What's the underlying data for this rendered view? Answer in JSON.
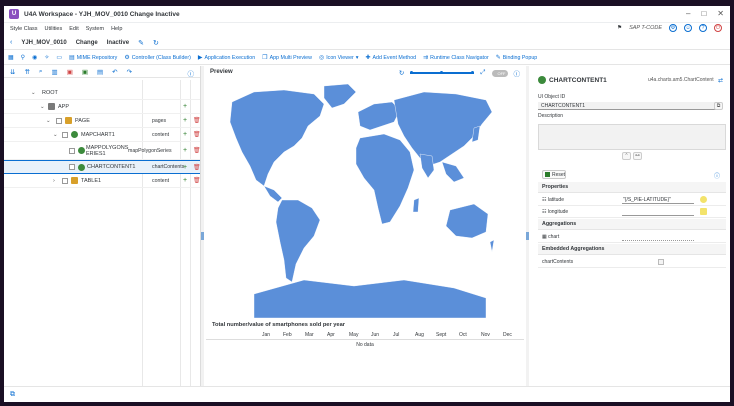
{
  "window": {
    "title": "U4A Workspace - YJH_MOV_0010 Change Inactive"
  },
  "menu": {
    "items": [
      "Style Class",
      "Utilities",
      "Edit",
      "System",
      "Help"
    ],
    "tcode_placeholder": "SAP T-CODE"
  },
  "object_bar": {
    "name": "YJH_MOV_0010",
    "mode": "Change",
    "status": "Inactive"
  },
  "toolbar": {
    "items": [
      "MIME Repository",
      "Controller (Class Builder)",
      "Application Execution",
      "App Multi Preview",
      "Icon Viewer",
      "Add Event Method",
      "Runtime Class Navigator",
      "Binding Popup"
    ]
  },
  "tree": {
    "rows": [
      {
        "label": "ROOT",
        "aggregation": "",
        "level": 0
      },
      {
        "label": "APP",
        "aggregation": "",
        "level": 1
      },
      {
        "label": "PAGE",
        "aggregation": "pages",
        "level": 2
      },
      {
        "label": "MAPCHART1",
        "aggregation": "content",
        "level": 3
      },
      {
        "label": "MAPPOLYGONSERIES1",
        "aggregation": "mapPolygonSeries",
        "level": 4
      },
      {
        "label": "CHARTCONTENT1",
        "aggregation": "chartContents",
        "level": 4
      },
      {
        "label": "TABLE1",
        "aggregation": "content",
        "level": 3
      }
    ]
  },
  "preview": {
    "label": "Preview",
    "toggle_label": "OFF",
    "chart_title": "Total number/value of smartphones sold per year",
    "months": [
      "Jan",
      "Feb",
      "Mar",
      "Apr",
      "May",
      "Jun",
      "Jul",
      "Aug",
      "Sept",
      "Oct",
      "Nov",
      "Dec"
    ],
    "no_data": "No data",
    "map_color": "#5b8fd9"
  },
  "properties_panel": {
    "object_name": "CHARTCONTENT1",
    "class_name": "u4a.charts.am5.ChartContent",
    "ui_object_id_label": "UI Object ID",
    "ui_object_id_value": "CHARTCONTENT1",
    "description_label": "Description",
    "reset_label": "Reset",
    "properties_label": "Properties",
    "properties": [
      {
        "name": "latitude",
        "value": "\"{/S_PIE-LATITUDE}\""
      },
      {
        "name": "longitude",
        "value": ""
      }
    ],
    "aggregations_label": "Aggregations",
    "aggregations": [
      {
        "name": "chart",
        "value": ""
      }
    ],
    "embedded_label": "Embedded Aggregations",
    "embedded": [
      {
        "name": "chartContents",
        "value": ""
      }
    ]
  }
}
